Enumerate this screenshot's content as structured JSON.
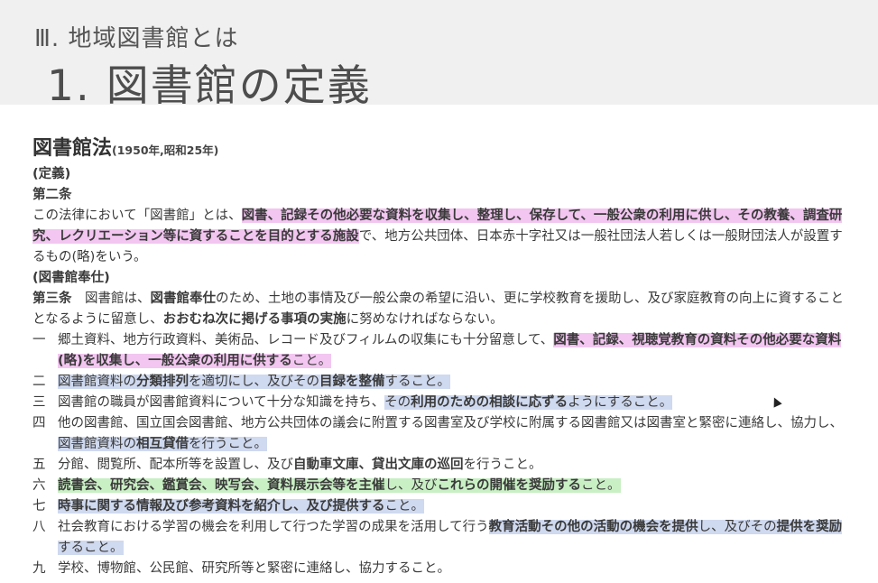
{
  "header": {
    "subtitle": "Ⅲ. 地域図書館とは",
    "title": "1. 図書館の定義"
  },
  "law": {
    "title": "図書館法",
    "year": "(1950年,昭和25年)"
  },
  "article2": {
    "heading": "(定義)",
    "label": "第二条",
    "t1": "この法律において「図書館」とは、",
    "h1": "図書、記録その他必要な資料を収集し、整理し、保存して、一般公衆の利用に供し、その教養、調査研究、レクリエーション等に資することを目的とする施設",
    "t2": "で、地方公共団体、日本赤十字社又は一般社団法人若しくは一般財団法人が設置するもの(略)をいう。"
  },
  "article3": {
    "heading": "(図書館奉仕)",
    "label": "第三条",
    "t1": "　図書館は、",
    "b1": "図書館奉仕",
    "t2": "のため、土地の事情及び一般公衆の希望に沿い、更に学校教育を援助し、及び家庭教育の向上に資することとなるように留意し、",
    "b2": "おおむね次に掲げる事項の実施",
    "t3": "に努めなければならない。"
  },
  "items": [
    {
      "num": "一",
      "t1": "郷土資料、地方行政資料、美術品、レコード及びフィルムの収集にも十分留意して、",
      "h1": "図書、記録、視聴覚教育の資料その他必要な資料(略)を収集し、一般公衆の利用に供する",
      "h2": "こと。"
    },
    {
      "num": "二",
      "h1a": "図書館資料の",
      "h1b": "分類排列",
      "h1c": "を適切にし、及びその",
      "h1d": "目録を整備",
      "h1e": "すること。"
    },
    {
      "num": "三",
      "t1": "図書館の職員が図書館資料について十分な知識を持ち、",
      "h1a": "その",
      "h1b": "利用のための相談に応ずる",
      "h1c": "ようにすること。"
    },
    {
      "num": "四",
      "t1": "他の図書館、国立国会図書館、地方公共団体の議会に附置する図書室及び学校に附属する図書館又は図書室と緊密に連絡し、協力し、",
      "h1a": "図書館資料の",
      "h1b": "相互貸借",
      "h1c": "を行うこと。"
    },
    {
      "num": "五",
      "t1": "分館、閲覧所、配本所等を設置し、及び",
      "b1": "自動車文庫、貸出文庫の巡回",
      "t2": "を行うこと。"
    },
    {
      "num": "六",
      "h1a": "読書会、研究会、鑑賞会、映写会、資料展示会等を主催",
      "h1b": "し、及び",
      "h1c": "これらの開催を奨励する",
      "h1d": "こと。"
    },
    {
      "num": "七",
      "h1a": "時事に関する情報及び参考資料を紹介",
      "h1b": "し、及び",
      "h1c": "提供する",
      "h1d": "こと。"
    },
    {
      "num": "八",
      "t1": "社会教育における学習の機会を利用して行つた学習の成果を活用して行う",
      "h1a": "教育活動その他の活動の機会を提供",
      "h1b": "し、及びその",
      "h1c": "提供を奨励",
      "h1d": "すること。"
    },
    {
      "num": "九",
      "t1": "学校、博物館、公民館、研究所等と緊密に連絡し、協力すること。"
    }
  ]
}
